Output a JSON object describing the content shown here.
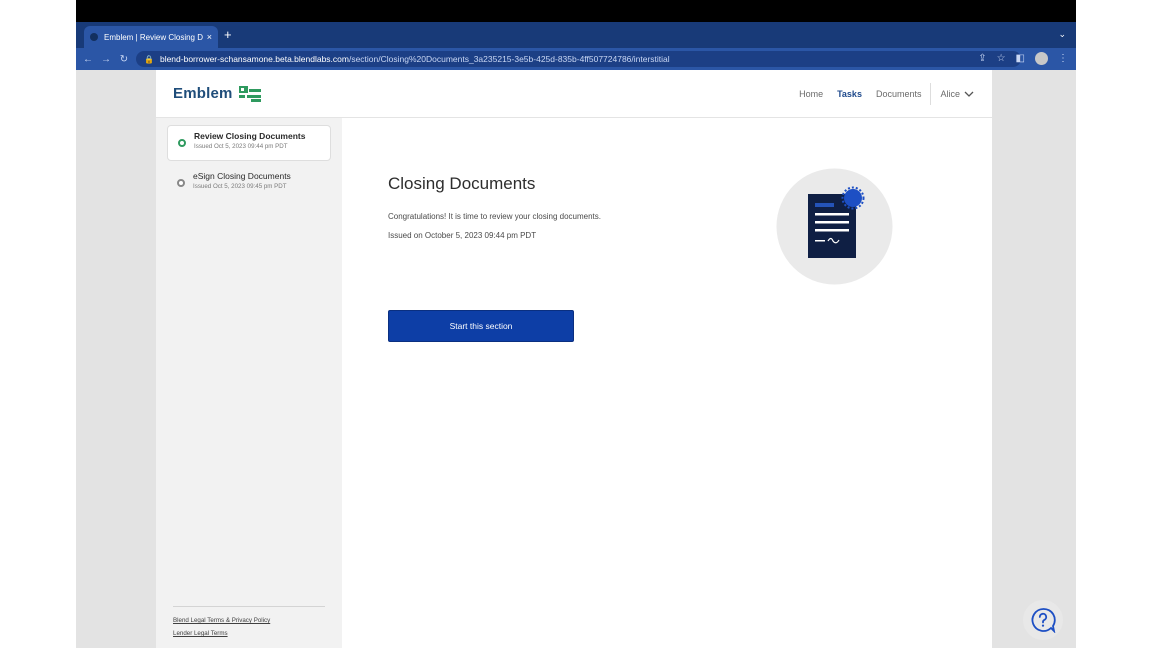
{
  "browser": {
    "tab_title": "Emblem | Review Closing Docu",
    "tab_close": "×",
    "new_tab": "+",
    "tab_menu": "⌄",
    "url_host": "blend-borrower-schansamone.beta.blendlabs.com",
    "url_path": "/section/Closing%20Documents_3a235215-3e5b-425d-835b-4ff507724786/interstitial"
  },
  "app": {
    "brand": "Emblem",
    "nav": {
      "home": "Home",
      "tasks": "Tasks",
      "documents": "Documents",
      "user": "Alice"
    },
    "colors": {
      "accent": "#0d3ea6",
      "brand_text": "#1f4d7a",
      "brand_mark": "#2f9a5f",
      "active_dot": "#2f9a5f"
    }
  },
  "sidebar": {
    "steps": [
      {
        "title": "Review Closing Documents",
        "subtitle": "Issued Oct 5, 2023 09:44 pm PDT",
        "active": true
      },
      {
        "title": "eSign Closing Documents",
        "subtitle": "Issued Oct 5, 2023 09:45 pm PDT",
        "active": false
      }
    ],
    "footer_links": [
      "Blend Legal Terms & Privacy Policy",
      "Lender Legal Terms"
    ]
  },
  "main": {
    "heading": "Closing Documents",
    "message": "Congratulations! It is time to review your closing documents.",
    "issued": "Issued on October 5, 2023 09:44 pm PDT",
    "start_button": "Start this section"
  },
  "icons": {
    "illustration": "document-with-seal-icon",
    "help": "help-bubble-icon"
  }
}
